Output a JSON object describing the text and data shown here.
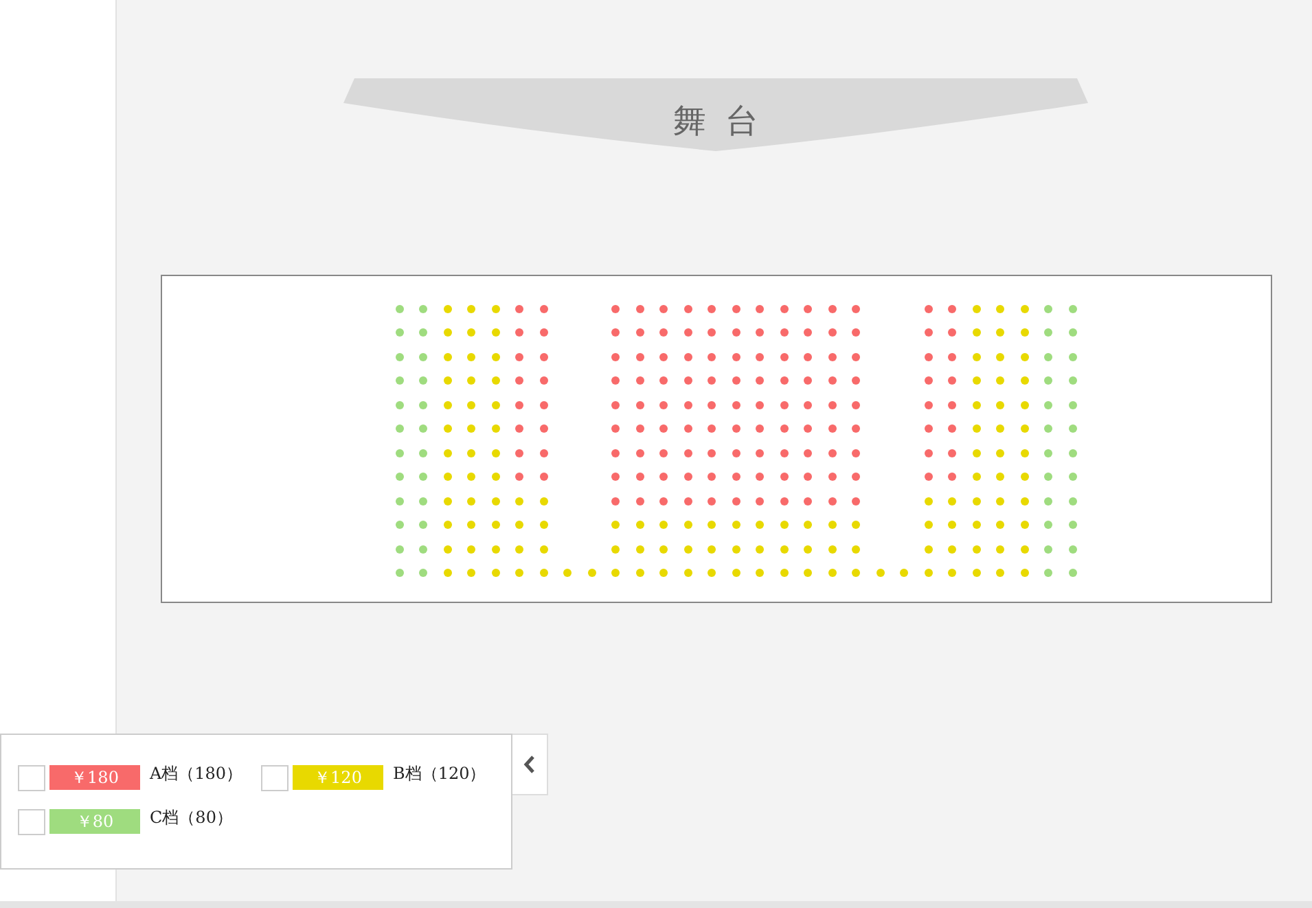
{
  "stage": {
    "label": "舞台"
  },
  "seat_map": {
    "rows": [
      [
        {
          "kind": "seat",
          "color": "#9fdc7f"
        },
        {
          "kind": "seat",
          "color": "#9fdc7f"
        },
        {
          "kind": "seat",
          "color": "#e8d900"
        },
        {
          "kind": "seat",
          "color": "#e8d900"
        },
        {
          "kind": "seat",
          "color": "#e8d900"
        },
        {
          "kind": "seat",
          "color": "#f86a6a"
        },
        {
          "kind": "seat",
          "color": "#f86a6a"
        },
        {
          "kind": "aisle"
        },
        {
          "kind": "aisle"
        },
        {
          "kind": "seat",
          "color": "#f86a6a"
        },
        {
          "kind": "seat",
          "color": "#f86a6a"
        },
        {
          "kind": "seat",
          "color": "#f86a6a"
        },
        {
          "kind": "seat",
          "color": "#f86a6a"
        },
        {
          "kind": "seat",
          "color": "#f86a6a"
        },
        {
          "kind": "seat",
          "color": "#f86a6a"
        },
        {
          "kind": "seat",
          "color": "#f86a6a"
        },
        {
          "kind": "seat",
          "color": "#f86a6a"
        },
        {
          "kind": "seat",
          "color": "#f86a6a"
        },
        {
          "kind": "seat",
          "color": "#f86a6a"
        },
        {
          "kind": "seat",
          "color": "#f86a6a"
        },
        {
          "kind": "aisle"
        },
        {
          "kind": "aisle"
        },
        {
          "kind": "seat",
          "color": "#f86a6a"
        },
        {
          "kind": "seat",
          "color": "#f86a6a"
        },
        {
          "kind": "seat",
          "color": "#e8d900"
        },
        {
          "kind": "seat",
          "color": "#e8d900"
        },
        {
          "kind": "seat",
          "color": "#e8d900"
        },
        {
          "kind": "seat",
          "color": "#9fdc7f"
        },
        {
          "kind": "seat",
          "color": "#9fdc7f"
        }
      ],
      [
        {
          "kind": "seat",
          "color": "#9fdc7f"
        },
        {
          "kind": "seat",
          "color": "#9fdc7f"
        },
        {
          "kind": "seat",
          "color": "#e8d900"
        },
        {
          "kind": "seat",
          "color": "#e8d900"
        },
        {
          "kind": "seat",
          "color": "#e8d900"
        },
        {
          "kind": "seat",
          "color": "#f86a6a"
        },
        {
          "kind": "seat",
          "color": "#f86a6a"
        },
        {
          "kind": "aisle"
        },
        {
          "kind": "aisle"
        },
        {
          "kind": "seat",
          "color": "#f86a6a"
        },
        {
          "kind": "seat",
          "color": "#f86a6a"
        },
        {
          "kind": "seat",
          "color": "#f86a6a"
        },
        {
          "kind": "seat",
          "color": "#f86a6a"
        },
        {
          "kind": "seat",
          "color": "#f86a6a"
        },
        {
          "kind": "seat",
          "color": "#f86a6a"
        },
        {
          "kind": "seat",
          "color": "#f86a6a"
        },
        {
          "kind": "seat",
          "color": "#f86a6a"
        },
        {
          "kind": "seat",
          "color": "#f86a6a"
        },
        {
          "kind": "seat",
          "color": "#f86a6a"
        },
        {
          "kind": "seat",
          "color": "#f86a6a"
        },
        {
          "kind": "aisle"
        },
        {
          "kind": "aisle"
        },
        {
          "kind": "seat",
          "color": "#f86a6a"
        },
        {
          "kind": "seat",
          "color": "#f86a6a"
        },
        {
          "kind": "seat",
          "color": "#e8d900"
        },
        {
          "kind": "seat",
          "color": "#e8d900"
        },
        {
          "kind": "seat",
          "color": "#e8d900"
        },
        {
          "kind": "seat",
          "color": "#9fdc7f"
        },
        {
          "kind": "seat",
          "color": "#9fdc7f"
        }
      ],
      [
        {
          "kind": "seat",
          "color": "#9fdc7f"
        },
        {
          "kind": "seat",
          "color": "#9fdc7f"
        },
        {
          "kind": "seat",
          "color": "#e8d900"
        },
        {
          "kind": "seat",
          "color": "#e8d900"
        },
        {
          "kind": "seat",
          "color": "#e8d900"
        },
        {
          "kind": "seat",
          "color": "#f86a6a"
        },
        {
          "kind": "seat",
          "color": "#f86a6a"
        },
        {
          "kind": "aisle"
        },
        {
          "kind": "aisle"
        },
        {
          "kind": "seat",
          "color": "#f86a6a"
        },
        {
          "kind": "seat",
          "color": "#f86a6a"
        },
        {
          "kind": "seat",
          "color": "#f86a6a"
        },
        {
          "kind": "seat",
          "color": "#f86a6a"
        },
        {
          "kind": "seat",
          "color": "#f86a6a"
        },
        {
          "kind": "seat",
          "color": "#f86a6a"
        },
        {
          "kind": "seat",
          "color": "#f86a6a"
        },
        {
          "kind": "seat",
          "color": "#f86a6a"
        },
        {
          "kind": "seat",
          "color": "#f86a6a"
        },
        {
          "kind": "seat",
          "color": "#f86a6a"
        },
        {
          "kind": "seat",
          "color": "#f86a6a"
        },
        {
          "kind": "aisle"
        },
        {
          "kind": "aisle"
        },
        {
          "kind": "seat",
          "color": "#f86a6a"
        },
        {
          "kind": "seat",
          "color": "#f86a6a"
        },
        {
          "kind": "seat",
          "color": "#e8d900"
        },
        {
          "kind": "seat",
          "color": "#e8d900"
        },
        {
          "kind": "seat",
          "color": "#e8d900"
        },
        {
          "kind": "seat",
          "color": "#9fdc7f"
        },
        {
          "kind": "seat",
          "color": "#9fdc7f"
        }
      ],
      [
        {
          "kind": "seat",
          "color": "#9fdc7f"
        },
        {
          "kind": "seat",
          "color": "#9fdc7f"
        },
        {
          "kind": "seat",
          "color": "#e8d900"
        },
        {
          "kind": "seat",
          "color": "#e8d900"
        },
        {
          "kind": "seat",
          "color": "#e8d900"
        },
        {
          "kind": "seat",
          "color": "#f86a6a"
        },
        {
          "kind": "seat",
          "color": "#f86a6a"
        },
        {
          "kind": "aisle"
        },
        {
          "kind": "aisle"
        },
        {
          "kind": "seat",
          "color": "#f86a6a"
        },
        {
          "kind": "seat",
          "color": "#f86a6a"
        },
        {
          "kind": "seat",
          "color": "#f86a6a"
        },
        {
          "kind": "seat",
          "color": "#f86a6a"
        },
        {
          "kind": "seat",
          "color": "#f86a6a"
        },
        {
          "kind": "seat",
          "color": "#f86a6a"
        },
        {
          "kind": "seat",
          "color": "#f86a6a"
        },
        {
          "kind": "seat",
          "color": "#f86a6a"
        },
        {
          "kind": "seat",
          "color": "#f86a6a"
        },
        {
          "kind": "seat",
          "color": "#f86a6a"
        },
        {
          "kind": "seat",
          "color": "#f86a6a"
        },
        {
          "kind": "aisle"
        },
        {
          "kind": "aisle"
        },
        {
          "kind": "seat",
          "color": "#f86a6a"
        },
        {
          "kind": "seat",
          "color": "#f86a6a"
        },
        {
          "kind": "seat",
          "color": "#e8d900"
        },
        {
          "kind": "seat",
          "color": "#e8d900"
        },
        {
          "kind": "seat",
          "color": "#e8d900"
        },
        {
          "kind": "seat",
          "color": "#9fdc7f"
        },
        {
          "kind": "seat",
          "color": "#9fdc7f"
        }
      ],
      [
        {
          "kind": "seat",
          "color": "#9fdc7f"
        },
        {
          "kind": "seat",
          "color": "#9fdc7f"
        },
        {
          "kind": "seat",
          "color": "#e8d900"
        },
        {
          "kind": "seat",
          "color": "#e8d900"
        },
        {
          "kind": "seat",
          "color": "#e8d900"
        },
        {
          "kind": "seat",
          "color": "#f86a6a"
        },
        {
          "kind": "seat",
          "color": "#f86a6a"
        },
        {
          "kind": "aisle"
        },
        {
          "kind": "aisle"
        },
        {
          "kind": "seat",
          "color": "#f86a6a"
        },
        {
          "kind": "seat",
          "color": "#f86a6a"
        },
        {
          "kind": "seat",
          "color": "#f86a6a"
        },
        {
          "kind": "seat",
          "color": "#f86a6a"
        },
        {
          "kind": "seat",
          "color": "#f86a6a"
        },
        {
          "kind": "seat",
          "color": "#f86a6a"
        },
        {
          "kind": "seat",
          "color": "#f86a6a"
        },
        {
          "kind": "seat",
          "color": "#f86a6a"
        },
        {
          "kind": "seat",
          "color": "#f86a6a"
        },
        {
          "kind": "seat",
          "color": "#f86a6a"
        },
        {
          "kind": "seat",
          "color": "#f86a6a"
        },
        {
          "kind": "aisle"
        },
        {
          "kind": "aisle"
        },
        {
          "kind": "seat",
          "color": "#f86a6a"
        },
        {
          "kind": "seat",
          "color": "#f86a6a"
        },
        {
          "kind": "seat",
          "color": "#e8d900"
        },
        {
          "kind": "seat",
          "color": "#e8d900"
        },
        {
          "kind": "seat",
          "color": "#e8d900"
        },
        {
          "kind": "seat",
          "color": "#9fdc7f"
        },
        {
          "kind": "seat",
          "color": "#9fdc7f"
        }
      ],
      [
        {
          "kind": "seat",
          "color": "#9fdc7f"
        },
        {
          "kind": "seat",
          "color": "#9fdc7f"
        },
        {
          "kind": "seat",
          "color": "#e8d900"
        },
        {
          "kind": "seat",
          "color": "#e8d900"
        },
        {
          "kind": "seat",
          "color": "#e8d900"
        },
        {
          "kind": "seat",
          "color": "#f86a6a"
        },
        {
          "kind": "seat",
          "color": "#f86a6a"
        },
        {
          "kind": "aisle"
        },
        {
          "kind": "aisle"
        },
        {
          "kind": "seat",
          "color": "#f86a6a"
        },
        {
          "kind": "seat",
          "color": "#f86a6a"
        },
        {
          "kind": "seat",
          "color": "#f86a6a"
        },
        {
          "kind": "seat",
          "color": "#f86a6a"
        },
        {
          "kind": "seat",
          "color": "#f86a6a"
        },
        {
          "kind": "seat",
          "color": "#f86a6a"
        },
        {
          "kind": "seat",
          "color": "#f86a6a"
        },
        {
          "kind": "seat",
          "color": "#f86a6a"
        },
        {
          "kind": "seat",
          "color": "#f86a6a"
        },
        {
          "kind": "seat",
          "color": "#f86a6a"
        },
        {
          "kind": "seat",
          "color": "#f86a6a"
        },
        {
          "kind": "aisle"
        },
        {
          "kind": "aisle"
        },
        {
          "kind": "seat",
          "color": "#f86a6a"
        },
        {
          "kind": "seat",
          "color": "#f86a6a"
        },
        {
          "kind": "seat",
          "color": "#e8d900"
        },
        {
          "kind": "seat",
          "color": "#e8d900"
        },
        {
          "kind": "seat",
          "color": "#e8d900"
        },
        {
          "kind": "seat",
          "color": "#9fdc7f"
        },
        {
          "kind": "seat",
          "color": "#9fdc7f"
        }
      ],
      [
        {
          "kind": "seat",
          "color": "#9fdc7f"
        },
        {
          "kind": "seat",
          "color": "#9fdc7f"
        },
        {
          "kind": "seat",
          "color": "#e8d900"
        },
        {
          "kind": "seat",
          "color": "#e8d900"
        },
        {
          "kind": "seat",
          "color": "#e8d900"
        },
        {
          "kind": "seat",
          "color": "#f86a6a"
        },
        {
          "kind": "seat",
          "color": "#f86a6a"
        },
        {
          "kind": "aisle"
        },
        {
          "kind": "aisle"
        },
        {
          "kind": "seat",
          "color": "#f86a6a"
        },
        {
          "kind": "seat",
          "color": "#f86a6a"
        },
        {
          "kind": "seat",
          "color": "#f86a6a"
        },
        {
          "kind": "seat",
          "color": "#f86a6a"
        },
        {
          "kind": "seat",
          "color": "#f86a6a"
        },
        {
          "kind": "seat",
          "color": "#f86a6a"
        },
        {
          "kind": "seat",
          "color": "#f86a6a"
        },
        {
          "kind": "seat",
          "color": "#f86a6a"
        },
        {
          "kind": "seat",
          "color": "#f86a6a"
        },
        {
          "kind": "seat",
          "color": "#f86a6a"
        },
        {
          "kind": "seat",
          "color": "#f86a6a"
        },
        {
          "kind": "aisle"
        },
        {
          "kind": "aisle"
        },
        {
          "kind": "seat",
          "color": "#f86a6a"
        },
        {
          "kind": "seat",
          "color": "#f86a6a"
        },
        {
          "kind": "seat",
          "color": "#e8d900"
        },
        {
          "kind": "seat",
          "color": "#e8d900"
        },
        {
          "kind": "seat",
          "color": "#e8d900"
        },
        {
          "kind": "seat",
          "color": "#9fdc7f"
        },
        {
          "kind": "seat",
          "color": "#9fdc7f"
        }
      ],
      [
        {
          "kind": "seat",
          "color": "#9fdc7f"
        },
        {
          "kind": "seat",
          "color": "#9fdc7f"
        },
        {
          "kind": "seat",
          "color": "#e8d900"
        },
        {
          "kind": "seat",
          "color": "#e8d900"
        },
        {
          "kind": "seat",
          "color": "#e8d900"
        },
        {
          "kind": "seat",
          "color": "#f86a6a"
        },
        {
          "kind": "seat",
          "color": "#f86a6a"
        },
        {
          "kind": "aisle"
        },
        {
          "kind": "aisle"
        },
        {
          "kind": "seat",
          "color": "#f86a6a"
        },
        {
          "kind": "seat",
          "color": "#f86a6a"
        },
        {
          "kind": "seat",
          "color": "#f86a6a"
        },
        {
          "kind": "seat",
          "color": "#f86a6a"
        },
        {
          "kind": "seat",
          "color": "#f86a6a"
        },
        {
          "kind": "seat",
          "color": "#f86a6a"
        },
        {
          "kind": "seat",
          "color": "#f86a6a"
        },
        {
          "kind": "seat",
          "color": "#f86a6a"
        },
        {
          "kind": "seat",
          "color": "#f86a6a"
        },
        {
          "kind": "seat",
          "color": "#f86a6a"
        },
        {
          "kind": "seat",
          "color": "#f86a6a"
        },
        {
          "kind": "aisle"
        },
        {
          "kind": "aisle"
        },
        {
          "kind": "seat",
          "color": "#f86a6a"
        },
        {
          "kind": "seat",
          "color": "#f86a6a"
        },
        {
          "kind": "seat",
          "color": "#e8d900"
        },
        {
          "kind": "seat",
          "color": "#e8d900"
        },
        {
          "kind": "seat",
          "color": "#e8d900"
        },
        {
          "kind": "seat",
          "color": "#9fdc7f"
        },
        {
          "kind": "seat",
          "color": "#9fdc7f"
        }
      ],
      [
        {
          "kind": "seat",
          "color": "#9fdc7f"
        },
        {
          "kind": "seat",
          "color": "#9fdc7f"
        },
        {
          "kind": "seat",
          "color": "#e8d900"
        },
        {
          "kind": "seat",
          "color": "#e8d900"
        },
        {
          "kind": "seat",
          "color": "#e8d900"
        },
        {
          "kind": "seat",
          "color": "#e8d900"
        },
        {
          "kind": "seat",
          "color": "#e8d900"
        },
        {
          "kind": "aisle"
        },
        {
          "kind": "aisle"
        },
        {
          "kind": "seat",
          "color": "#f86a6a"
        },
        {
          "kind": "seat",
          "color": "#f86a6a"
        },
        {
          "kind": "seat",
          "color": "#f86a6a"
        },
        {
          "kind": "seat",
          "color": "#f86a6a"
        },
        {
          "kind": "seat",
          "color": "#f86a6a"
        },
        {
          "kind": "seat",
          "color": "#f86a6a"
        },
        {
          "kind": "seat",
          "color": "#f86a6a"
        },
        {
          "kind": "seat",
          "color": "#f86a6a"
        },
        {
          "kind": "seat",
          "color": "#f86a6a"
        },
        {
          "kind": "seat",
          "color": "#f86a6a"
        },
        {
          "kind": "seat",
          "color": "#f86a6a"
        },
        {
          "kind": "aisle"
        },
        {
          "kind": "aisle"
        },
        {
          "kind": "seat",
          "color": "#e8d900"
        },
        {
          "kind": "seat",
          "color": "#e8d900"
        },
        {
          "kind": "seat",
          "color": "#e8d900"
        },
        {
          "kind": "seat",
          "color": "#e8d900"
        },
        {
          "kind": "seat",
          "color": "#e8d900"
        },
        {
          "kind": "seat",
          "color": "#9fdc7f"
        },
        {
          "kind": "seat",
          "color": "#9fdc7f"
        }
      ],
      [
        {
          "kind": "seat",
          "color": "#9fdc7f"
        },
        {
          "kind": "seat",
          "color": "#9fdc7f"
        },
        {
          "kind": "seat",
          "color": "#e8d900"
        },
        {
          "kind": "seat",
          "color": "#e8d900"
        },
        {
          "kind": "seat",
          "color": "#e8d900"
        },
        {
          "kind": "seat",
          "color": "#e8d900"
        },
        {
          "kind": "seat",
          "color": "#e8d900"
        },
        {
          "kind": "aisle"
        },
        {
          "kind": "aisle"
        },
        {
          "kind": "seat",
          "color": "#e8d900"
        },
        {
          "kind": "seat",
          "color": "#e8d900"
        },
        {
          "kind": "seat",
          "color": "#e8d900"
        },
        {
          "kind": "seat",
          "color": "#e8d900"
        },
        {
          "kind": "seat",
          "color": "#e8d900"
        },
        {
          "kind": "seat",
          "color": "#e8d900"
        },
        {
          "kind": "seat",
          "color": "#e8d900"
        },
        {
          "kind": "seat",
          "color": "#e8d900"
        },
        {
          "kind": "seat",
          "color": "#e8d900"
        },
        {
          "kind": "seat",
          "color": "#e8d900"
        },
        {
          "kind": "seat",
          "color": "#e8d900"
        },
        {
          "kind": "aisle"
        },
        {
          "kind": "aisle"
        },
        {
          "kind": "seat",
          "color": "#e8d900"
        },
        {
          "kind": "seat",
          "color": "#e8d900"
        },
        {
          "kind": "seat",
          "color": "#e8d900"
        },
        {
          "kind": "seat",
          "color": "#e8d900"
        },
        {
          "kind": "seat",
          "color": "#e8d900"
        },
        {
          "kind": "seat",
          "color": "#9fdc7f"
        },
        {
          "kind": "seat",
          "color": "#9fdc7f"
        }
      ],
      [
        {
          "kind": "seat",
          "color": "#9fdc7f"
        },
        {
          "kind": "seat",
          "color": "#9fdc7f"
        },
        {
          "kind": "seat",
          "color": "#e8d900"
        },
        {
          "kind": "seat",
          "color": "#e8d900"
        },
        {
          "kind": "seat",
          "color": "#e8d900"
        },
        {
          "kind": "seat",
          "color": "#e8d900"
        },
        {
          "kind": "seat",
          "color": "#e8d900"
        },
        {
          "kind": "aisle"
        },
        {
          "kind": "aisle"
        },
        {
          "kind": "seat",
          "color": "#e8d900"
        },
        {
          "kind": "seat",
          "color": "#e8d900"
        },
        {
          "kind": "seat",
          "color": "#e8d900"
        },
        {
          "kind": "seat",
          "color": "#e8d900"
        },
        {
          "kind": "seat",
          "color": "#e8d900"
        },
        {
          "kind": "seat",
          "color": "#e8d900"
        },
        {
          "kind": "seat",
          "color": "#e8d900"
        },
        {
          "kind": "seat",
          "color": "#e8d900"
        },
        {
          "kind": "seat",
          "color": "#e8d900"
        },
        {
          "kind": "seat",
          "color": "#e8d900"
        },
        {
          "kind": "seat",
          "color": "#e8d900"
        },
        {
          "kind": "aisle"
        },
        {
          "kind": "aisle"
        },
        {
          "kind": "seat",
          "color": "#e8d900"
        },
        {
          "kind": "seat",
          "color": "#e8d900"
        },
        {
          "kind": "seat",
          "color": "#e8d900"
        },
        {
          "kind": "seat",
          "color": "#e8d900"
        },
        {
          "kind": "seat",
          "color": "#e8d900"
        },
        {
          "kind": "seat",
          "color": "#9fdc7f"
        },
        {
          "kind": "seat",
          "color": "#9fdc7f"
        }
      ],
      [
        {
          "kind": "seat",
          "color": "#9fdc7f"
        },
        {
          "kind": "seat",
          "color": "#9fdc7f"
        },
        {
          "kind": "seat",
          "color": "#e8d900"
        },
        {
          "kind": "seat",
          "color": "#e8d900"
        },
        {
          "kind": "seat",
          "color": "#e8d900"
        },
        {
          "kind": "seat",
          "color": "#e8d900"
        },
        {
          "kind": "seat",
          "color": "#e8d900"
        },
        {
          "kind": "seat",
          "color": "#e8d900"
        },
        {
          "kind": "seat",
          "color": "#e8d900"
        },
        {
          "kind": "seat",
          "color": "#e8d900"
        },
        {
          "kind": "seat",
          "color": "#e8d900"
        },
        {
          "kind": "seat",
          "color": "#e8d900"
        },
        {
          "kind": "seat",
          "color": "#e8d900"
        },
        {
          "kind": "seat",
          "color": "#e8d900"
        },
        {
          "kind": "seat",
          "color": "#e8d900"
        },
        {
          "kind": "seat",
          "color": "#e8d900"
        },
        {
          "kind": "seat",
          "color": "#e8d900"
        },
        {
          "kind": "seat",
          "color": "#e8d900"
        },
        {
          "kind": "seat",
          "color": "#e8d900"
        },
        {
          "kind": "seat",
          "color": "#e8d900"
        },
        {
          "kind": "seat",
          "color": "#e8d900"
        },
        {
          "kind": "seat",
          "color": "#e8d900"
        },
        {
          "kind": "seat",
          "color": "#e8d900"
        },
        {
          "kind": "seat",
          "color": "#e8d900"
        },
        {
          "kind": "seat",
          "color": "#e8d900"
        },
        {
          "kind": "seat",
          "color": "#e8d900"
        },
        {
          "kind": "seat",
          "color": "#e8d900"
        },
        {
          "kind": "seat",
          "color": "#9fdc7f"
        },
        {
          "kind": "seat",
          "color": "#9fdc7f"
        }
      ]
    ]
  },
  "legend": {
    "tiers": [
      {
        "price": "￥180",
        "label": "A档（180）",
        "color": "#f86a6a",
        "checked": false
      },
      {
        "price": "￥120",
        "label": "B档（120）",
        "color": "#e8d900",
        "checked": false
      },
      {
        "price": "￥80",
        "label": "C档（80）",
        "color": "#9fdc7f",
        "checked": false
      }
    ]
  }
}
